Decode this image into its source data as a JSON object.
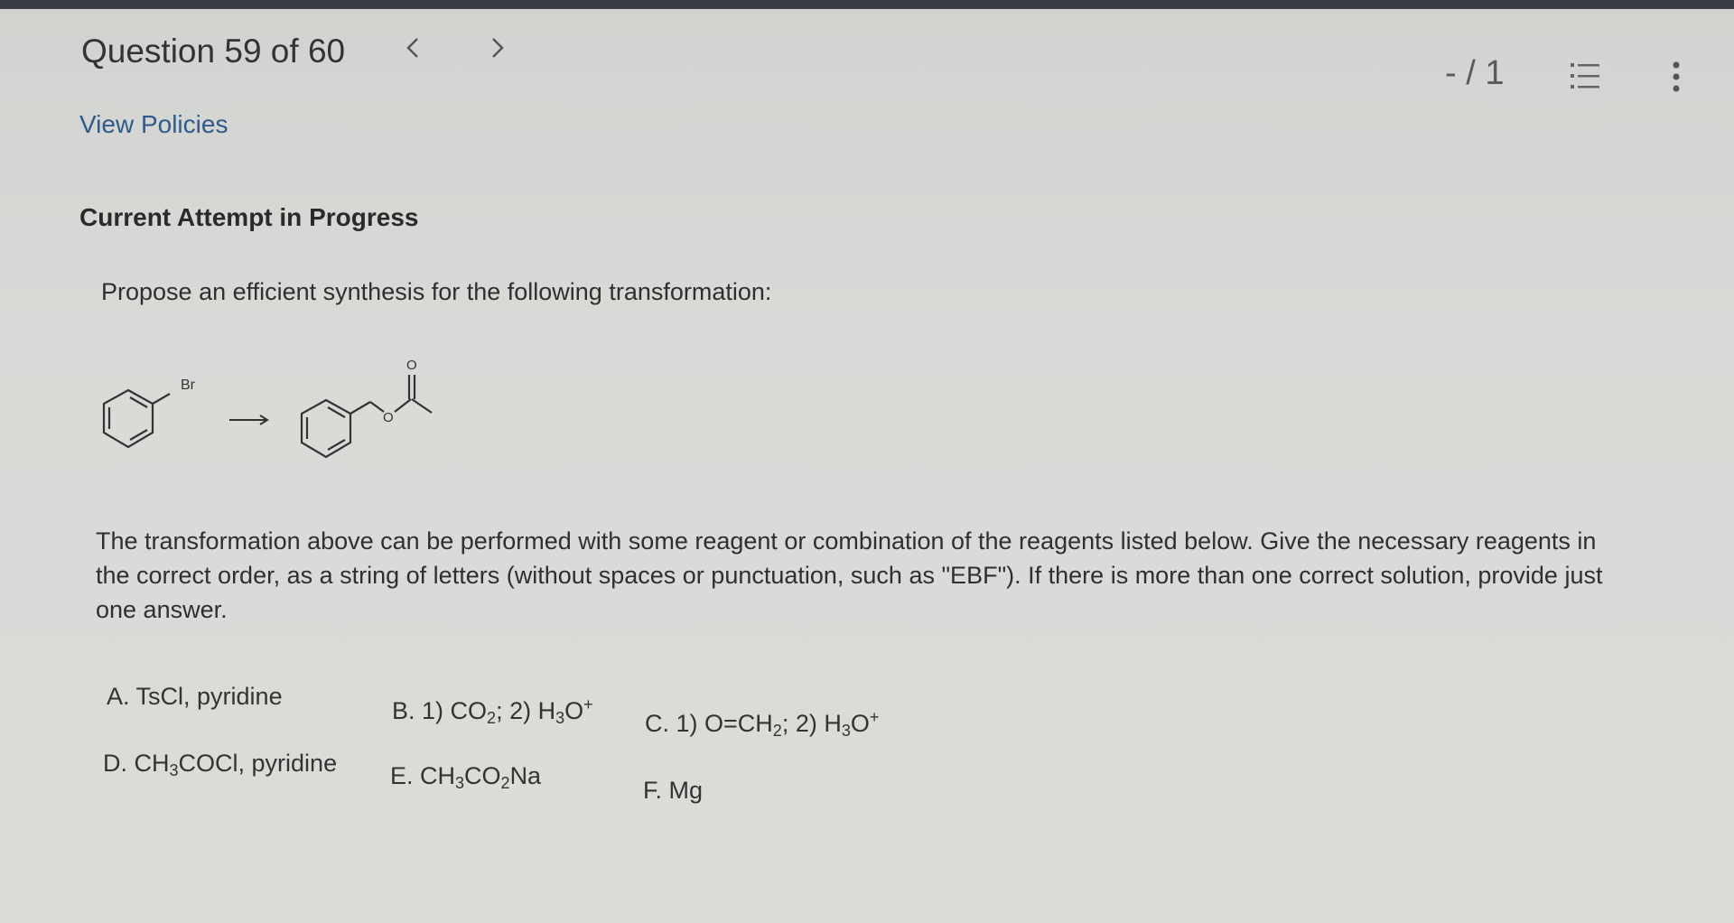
{
  "header": {
    "question_label": "Question 59 of 60",
    "prev_icon": "chevron-left-icon",
    "next_icon": "chevron-right-icon",
    "score": "- / 1",
    "list_icon": "list-icon",
    "more_icon": "more-vertical-icon"
  },
  "links": {
    "view_policies": "View Policies"
  },
  "status": {
    "attempt": "Current Attempt in Progress"
  },
  "question": {
    "prompt": "Propose an efficient synthesis for the following transformation:",
    "scheme": {
      "reactant_label": "Br",
      "product_carbonyl_label": "O",
      "product_ester_label": "O"
    },
    "instructions": "The transformation above can be performed with some reagent or combination of the reagents listed below. Give the necessary reagents in the correct order, as a string of letters (without spaces or punctuation, such as \"EBF\"). If there is more than one correct solution, provide just one answer."
  },
  "options": {
    "A": {
      "letter": "A.",
      "text": "TsCl, pyridine"
    },
    "B": {
      "letter": "B.",
      "p1": "1) CO",
      "s1": "2",
      "p2": "; 2) H",
      "s2": "3",
      "p3": "O",
      "sup": "+"
    },
    "C": {
      "letter": "C.",
      "p1": "1) O=CH",
      "s1": "2",
      "p2": "; 2) H",
      "s2": "3",
      "p3": "O",
      "sup": "+"
    },
    "D": {
      "letter": "D.",
      "p1": "CH",
      "s1": "3",
      "p2": "COCl, pyridine"
    },
    "E": {
      "letter": "E.",
      "p1": "CH",
      "s1": "3",
      "p2": "CO",
      "s2": "2",
      "p3": "Na"
    },
    "F": {
      "letter": "F.",
      "text": "Mg"
    }
  }
}
